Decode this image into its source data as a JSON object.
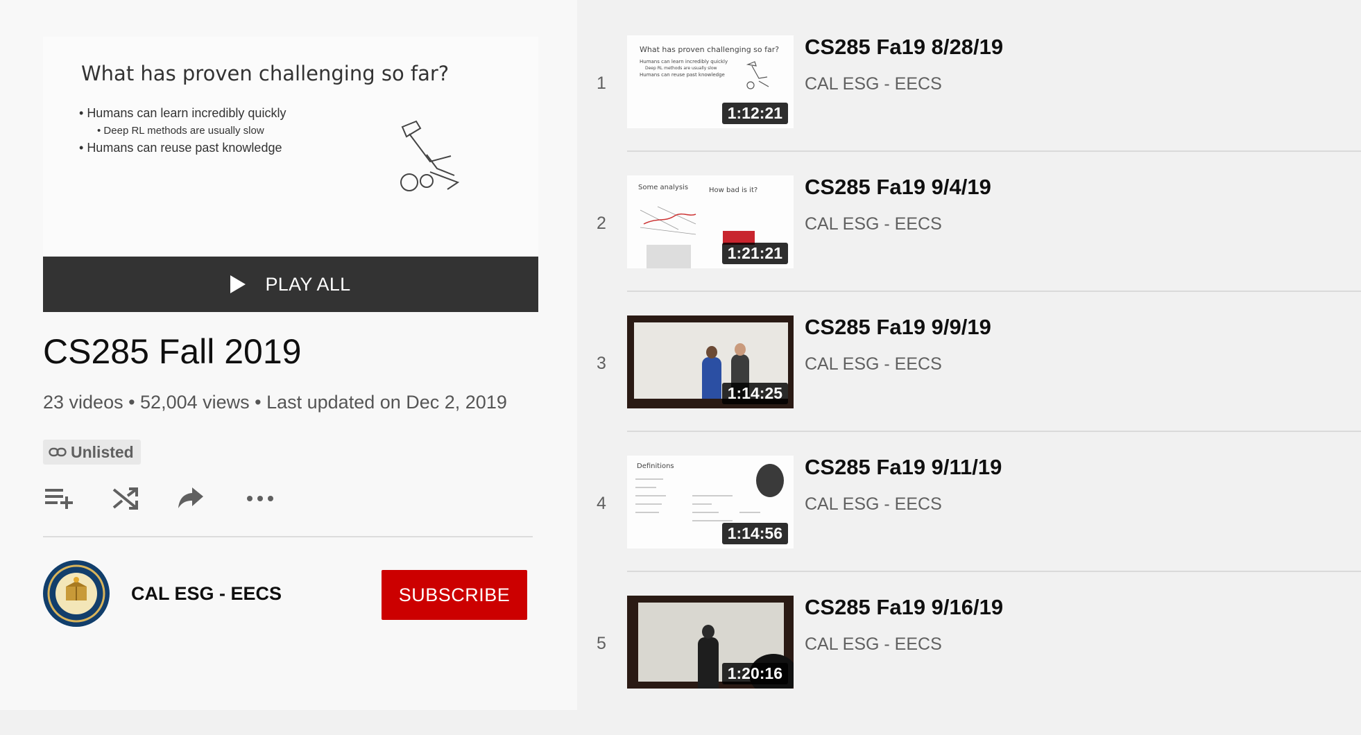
{
  "hero": {
    "slide_title": "What has proven challenging so far?",
    "slide_bullets": [
      "Humans can learn incredibly quickly",
      "Deep RL methods are usually slow",
      "Humans can reuse past knowledge"
    ],
    "play_all_label": "PLAY ALL"
  },
  "playlist": {
    "title": "CS285 Fall 2019",
    "stats": "23 videos • 52,004 views • Last updated on Dec 2, 2019",
    "privacy_label": "Unlisted"
  },
  "actions": {
    "icons": [
      "add-to-queue-icon",
      "shuffle-icon",
      "share-icon",
      "more-icon"
    ]
  },
  "owner": {
    "name": "CAL ESG - EECS",
    "subscribe_label": "SUBSCRIBE"
  },
  "colors": {
    "subscribe": "#cc0000",
    "play_all_bg": "#333333"
  },
  "videos": [
    {
      "index": "1",
      "title": "CS285 Fa19 8/28/19",
      "channel": "CAL ESG - EECS",
      "duration": "1:12:21",
      "slide_title": "What has proven challenging so far?",
      "slide_lines": [
        "Humans can learn incredibly quickly",
        "Deep RL methods are usually slow",
        "Humans can reuse past knowledge"
      ]
    },
    {
      "index": "2",
      "title": "CS285 Fa19 9/4/19",
      "channel": "CAL ESG - EECS",
      "duration": "1:21:21",
      "slide_title": "Some analysis",
      "slide_sub": "How bad is it?"
    },
    {
      "index": "3",
      "title": "CS285 Fa19 9/9/19",
      "channel": "CAL ESG - EECS",
      "duration": "1:14:25"
    },
    {
      "index": "4",
      "title": "CS285 Fa19 9/11/19",
      "channel": "CAL ESG - EECS",
      "duration": "1:14:56",
      "slide_title": "Definitions"
    },
    {
      "index": "5",
      "title": "CS285 Fa19 9/16/19",
      "channel": "CAL ESG - EECS",
      "duration": "1:20:16"
    }
  ]
}
